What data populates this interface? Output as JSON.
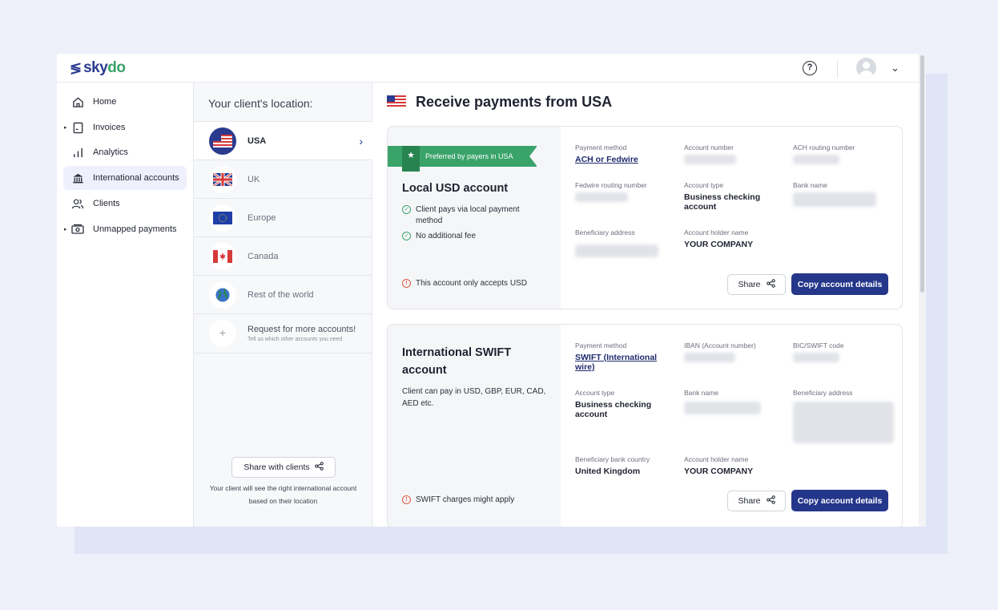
{
  "brand": {
    "name_start": "sky",
    "name_end": "do"
  },
  "nav": [
    {
      "label": "Home",
      "icon": "home-icon",
      "active": false
    },
    {
      "label": "Invoices",
      "icon": "invoice-icon",
      "active": false
    },
    {
      "label": "Analytics",
      "icon": "analytics-icon",
      "active": false
    },
    {
      "label": "International accounts",
      "icon": "bank-icon",
      "active": true
    },
    {
      "label": "Clients",
      "icon": "clients-icon",
      "active": false
    },
    {
      "label": "Unmapped payments",
      "icon": "cash-icon",
      "active": false
    }
  ],
  "locations": {
    "title": "Your client's location:",
    "items": [
      {
        "label": "USA",
        "selected": true
      },
      {
        "label": "UK",
        "selected": false
      },
      {
        "label": "Europe",
        "selected": false
      },
      {
        "label": "Canada",
        "selected": false
      },
      {
        "label": "Rest of the world",
        "selected": false
      }
    ],
    "request_title": "Request for more accounts!",
    "request_sub": "Tell us which other accounts you need",
    "share_button": "Share with clients",
    "share_note": "Your client will see the right international account based on their location"
  },
  "main": {
    "title": "Receive payments from USA",
    "local": {
      "ribbon": "Preferred by payers in USA",
      "title": "Local USD account",
      "features": [
        "Client pays via local payment method",
        "No additional fee"
      ],
      "warning": "This account only accepts USD",
      "fields": {
        "payment_method_label": "Payment method",
        "payment_method_value": "ACH or Fedwire",
        "account_number_label": "Account number",
        "ach_routing_label": "ACH routing number",
        "fedwire_routing_label": "Fedwire routing number",
        "account_type_label": "Account type",
        "account_type_value": "Business checking account",
        "bank_name_label": "Bank name",
        "beneficiary_address_label": "Beneficiary address",
        "holder_label": "Account holder name",
        "holder_value": "YOUR COMPANY"
      },
      "share": "Share",
      "copy": "Copy account details"
    },
    "swift": {
      "title": "International SWIFT account",
      "desc": "Client can pay in USD, GBP, EUR, CAD, AED etc.",
      "warning": "SWIFT charges might apply",
      "fields": {
        "payment_method_label": "Payment method",
        "payment_method_value": "SWIFT (International wire)",
        "iban_label": "IBAN (Account number)",
        "bic_label": "BIC/SWIFT code",
        "account_type_label": "Account type",
        "account_type_value": "Business checking account",
        "bank_name_label": "Bank name",
        "beneficiary_address_label": "Beneficiary address",
        "bank_country_label": "Beneficiary bank country",
        "bank_country_value": "United Kingdom",
        "holder_label": "Account holder name",
        "holder_value": "YOUR COMPANY"
      },
      "share": "Share",
      "copy": "Copy account details"
    }
  },
  "colors": {
    "brand": "#2a3b8f",
    "accent_green": "#3aa36a",
    "primary_button": "#25378a",
    "warning": "#e0583c"
  }
}
